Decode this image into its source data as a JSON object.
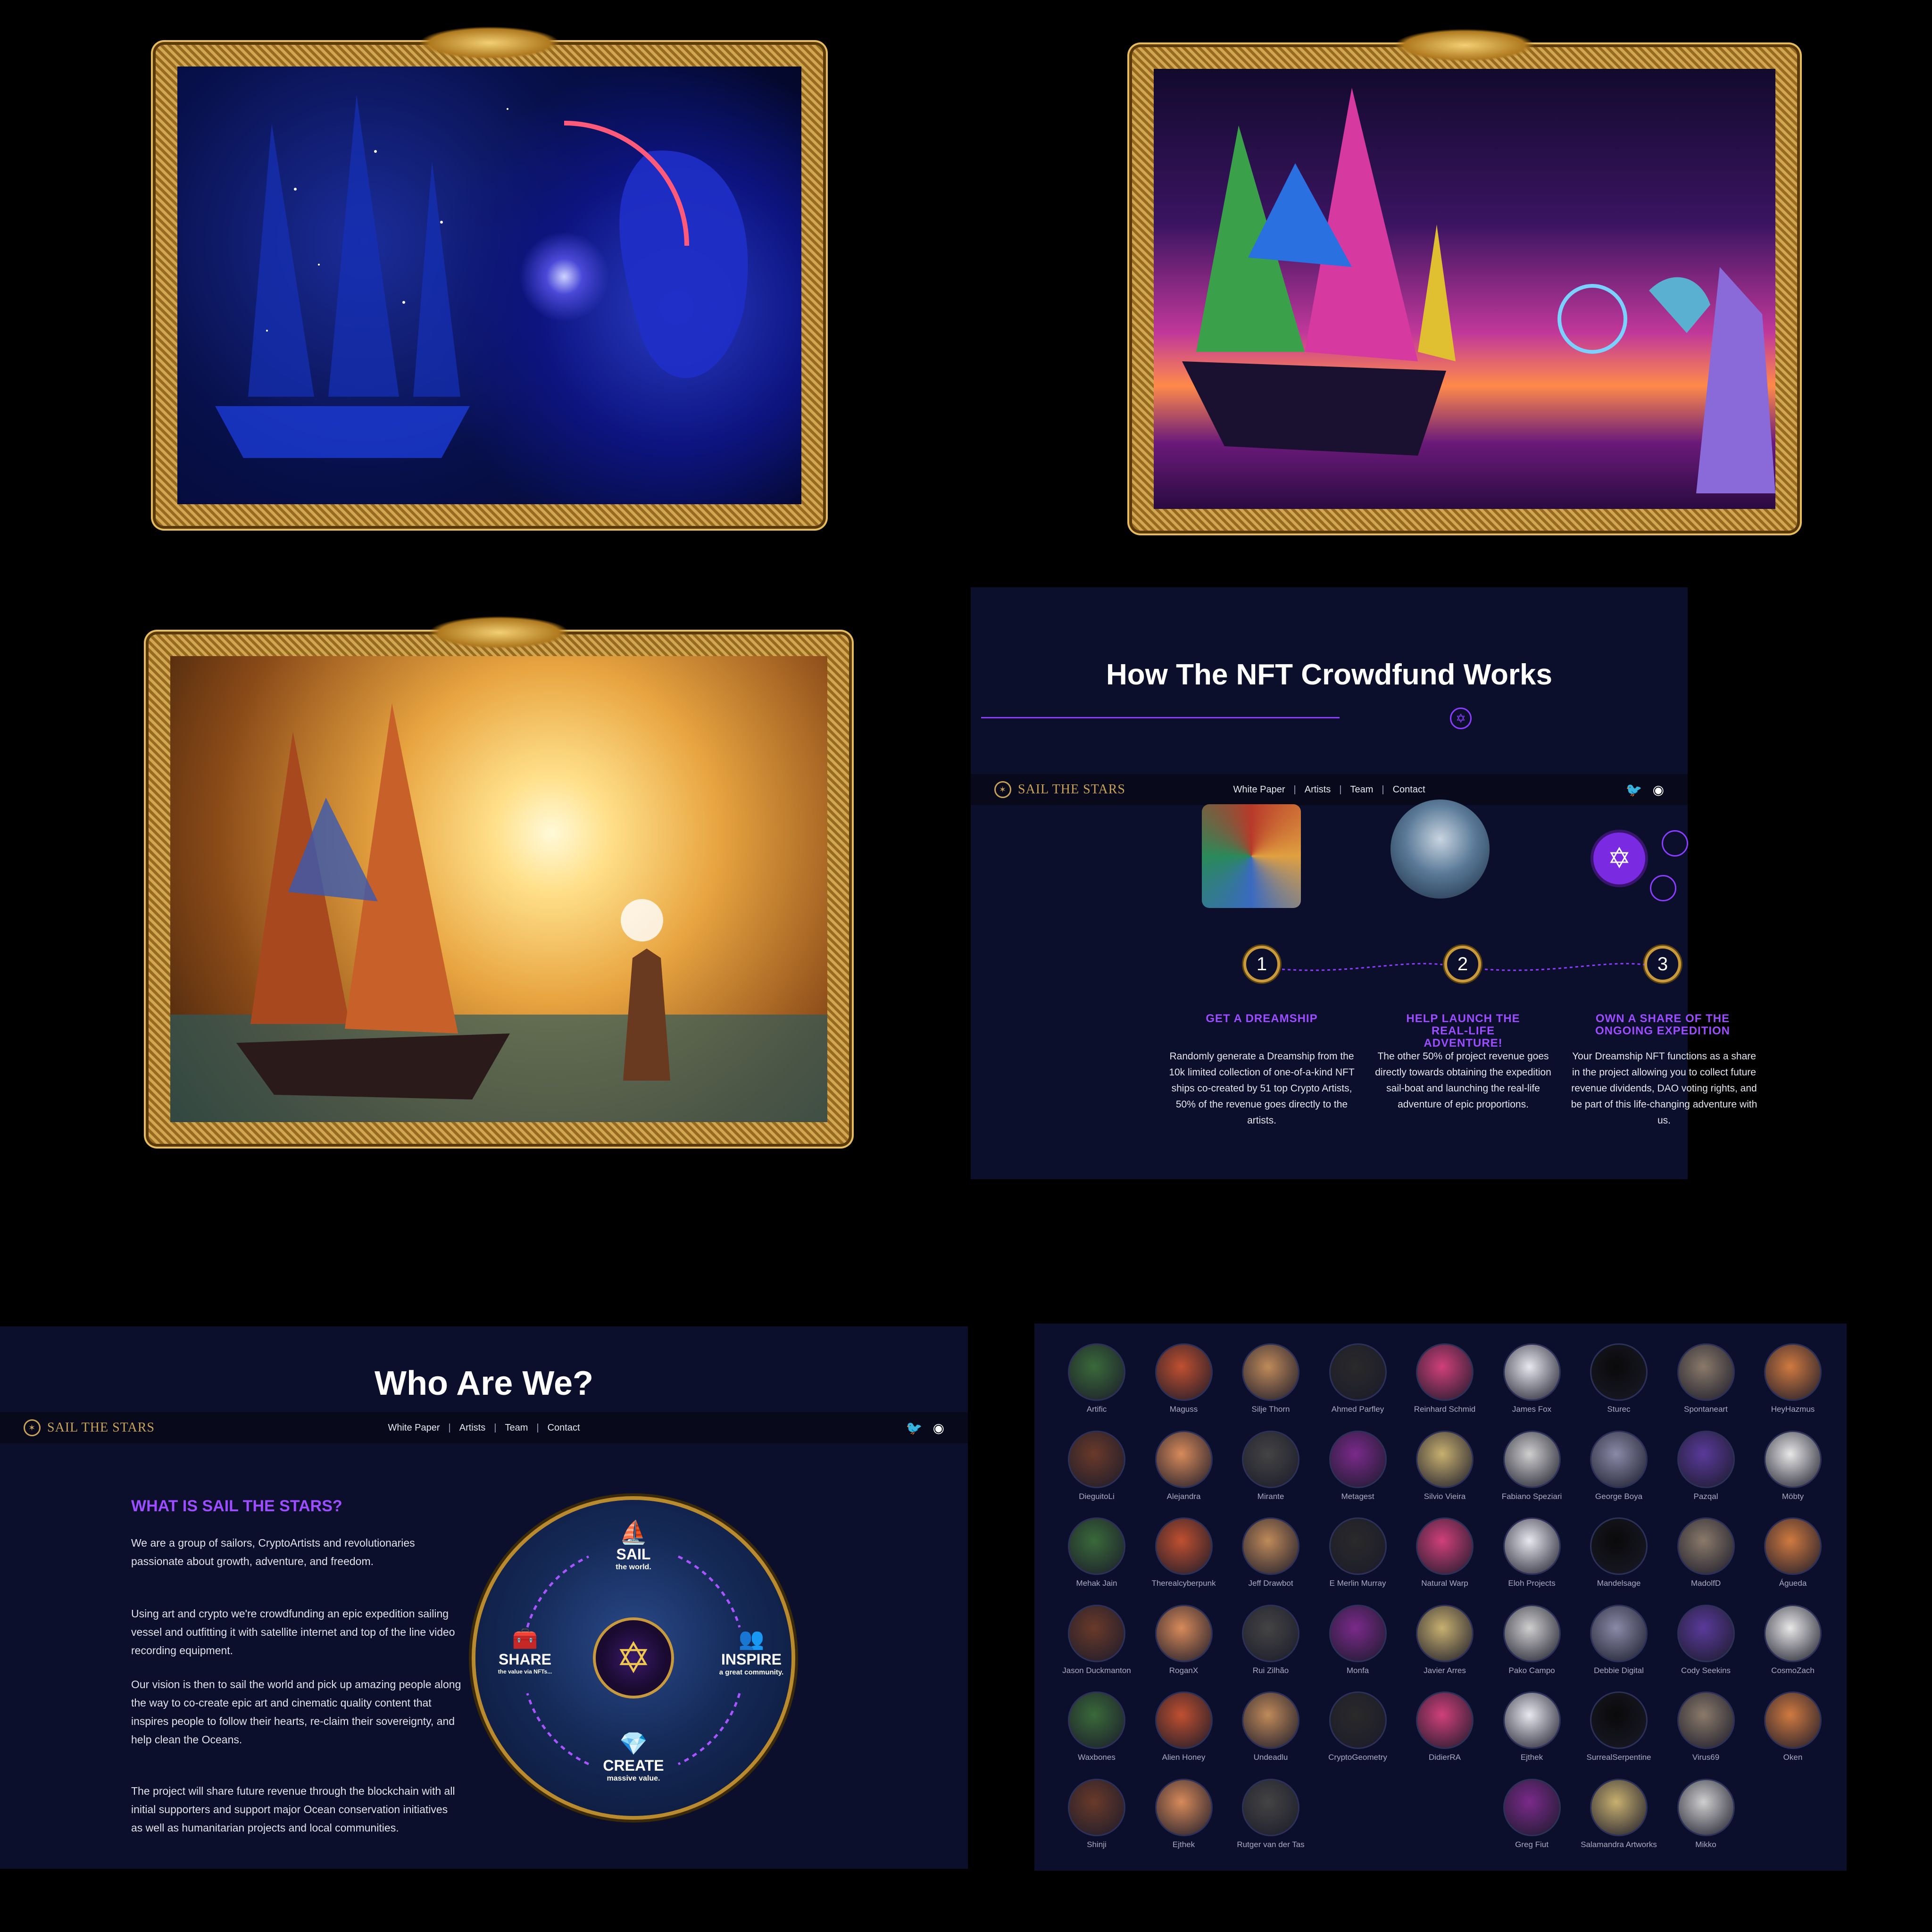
{
  "colors": {
    "page_bg": "#000000",
    "panel_bg": "#0c0f2b",
    "accent_purple": "#9b4dff",
    "gold": "#c99a3c"
  },
  "site": {
    "logo_text": "SAIL THE STARS",
    "nav": [
      "White Paper",
      "Artists",
      "Team",
      "Contact"
    ],
    "nav_sep": "|",
    "social_icons": [
      "twitter-icon",
      "discord-icon"
    ]
  },
  "crowdfund": {
    "title": "How The NFT Crowdfund Works",
    "steps": [
      {
        "num": "1",
        "heading": "GET A DREAMSHIP",
        "text": "Randomly generate a Dreamship from the 10k limited collection of one-of-a-kind NFT ships co-created by 51 top Crypto Artists, 50% of the revenue goes directly to the artists."
      },
      {
        "num": "2",
        "heading": "HELP LAUNCH THE REAL-LIFE ADVENTURE!",
        "text": "The other 50% of project revenue goes directly towards obtaining the expedition sail-boat and launching the real-life adventure of epic proportions."
      },
      {
        "num": "3",
        "heading": "OWN A SHARE OF THE ONGOING EXPEDITION",
        "text": "Your Dreamship NFT functions as a share in the project allowing you to collect future revenue dividends, DAO voting rights, and be part of this life-changing adventure with us."
      }
    ]
  },
  "who": {
    "title": "Who Are We?",
    "heading": "WHAT IS SAIL THE STARS?",
    "paragraphs": [
      "We are a group of sailors, CryptoArtists and revolutionaries passionate about growth, adventure, and freedom.",
      "Using art and crypto we're crowdfunding an epic expedition sailing vessel and outfitting it with satellite internet and top of the line video recording equipment.",
      "Our vision is then to sail the world and pick up amazing people along the way to co-create epic art and cinematic quality content that inspires people to follow their hearts, re-claim their sovereignty, and help clean the Oceans.",
      "The project will share future revenue through the blockchain with all initial supporters and support major Ocean conservation initiatives as well as humanitarian projects and local communities."
    ],
    "cycle": [
      {
        "label": "SAIL",
        "sub": "the world."
      },
      {
        "label": "INSPIRE",
        "sub": "a great community."
      },
      {
        "label": "CREATE",
        "sub": "massive value."
      },
      {
        "label": "SHARE",
        "sub": "the value via NFTs..."
      }
    ]
  },
  "artists": [
    "Artific",
    "Maguss",
    "Silje Thorn",
    "Ahmed Parfley",
    "Reinhard Schmid",
    "James Fox",
    "Sturec",
    "Spontaneart",
    "HeyHazmus",
    "DieguitoLi",
    "Alejandra",
    "Mirante",
    "Metagest",
    "Silvio Vieira",
    "Fabiano Speziari",
    "George Boya",
    "Pazqal",
    "Möbty",
    "Mehak Jain",
    "Therealcyberpunk",
    "Jeff Drawbot",
    "E Merlin Murray",
    "Natural Warp",
    "Eloh Projects",
    "Mandelsage",
    "MadolfD",
    "Águeda",
    "Jason Duckmanton",
    "RoganX",
    "Rui Zilhão",
    "Monfa",
    "Javier Arres",
    "Pako Campo",
    "Debbie Digital",
    "Cody Seekins",
    "CosmoZach",
    "Waxbones",
    "Alien Honey",
    "Undeadlu",
    "CryptoGeometry",
    "DidierRA",
    "Ejthek",
    "SurrealSerpentine",
    "Virus69",
    "Oken",
    "Shinji",
    "Ejthek",
    "Rutger van der Tas",
    "Greg Fiut",
    "Salamandra Artworks",
    "Mikko"
  ]
}
